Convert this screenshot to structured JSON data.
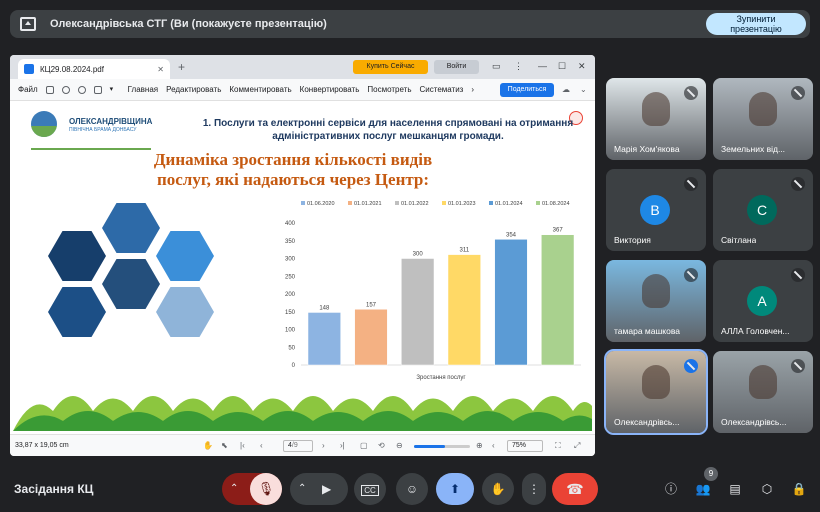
{
  "topbar": {
    "title": "Олександрівська СТГ (Ви (покажуєте презентацію)",
    "stop_label_1": "Зупинити",
    "stop_label_2": "презентацію"
  },
  "pdf": {
    "tab_title": "КЦ29.08.2024.pdf",
    "buy_label": "Купить Сейчас",
    "login_label": "Войти",
    "menu": [
      "Файл",
      "Главная",
      "Редактировать",
      "Комментировать",
      "Конвертировать",
      "Посмотреть",
      "Систематиз"
    ],
    "share_label": "Поделиться",
    "dimensions": "33,87 x 19,05 cm",
    "page": "4",
    "page_total": "/9",
    "zoom": "75%",
    "zoom_level": 0.55
  },
  "slide": {
    "logo_title": "ОЛЕКСАНДРІВЩИНА",
    "logo_subtitle": "ПІВНІЧНА БРАМА ДОНБАСУ",
    "heading": "1. Послуги та електронні сервіси для населення спрямовані на отримання адміністративних послуг мешканцям громади.",
    "title_line1": "Динаміка зростання кількості видів",
    "title_line2": "послуг, які надаються через Центр:"
  },
  "chart_data": {
    "type": "bar",
    "categories": [
      "01.06.2020",
      "01.01.2021",
      "01.01.2022",
      "01.01.2023",
      "01.01.2024",
      "01.08.2024"
    ],
    "values": [
      148,
      157,
      300,
      311,
      354,
      367
    ],
    "colors": [
      "#8db4e2",
      "#f4b183",
      "#bfbfbf",
      "#ffd966",
      "#5b9bd5",
      "#a9d18e"
    ],
    "yticks": [
      0,
      50,
      100,
      150,
      200,
      250,
      300,
      350,
      400
    ],
    "ylim": [
      0,
      400
    ],
    "xlabel": "Зростання послуг",
    "legend": "top"
  },
  "participants": [
    {
      "name": "Марія Хом'якова",
      "type": "photo",
      "bg": "#dfe6e9"
    },
    {
      "name": "Земельних від...",
      "type": "photo",
      "bg": "#b0b8bf"
    },
    {
      "name": "Виктория",
      "type": "avatar",
      "letter": "В",
      "color": "#1e88e5"
    },
    {
      "name": "Світлана",
      "type": "avatar",
      "letter": "С",
      "color": "#00695c"
    },
    {
      "name": "тамара машкова",
      "type": "photo",
      "bg": "#7ab8e0"
    },
    {
      "name": "АЛЛА Головчен...",
      "type": "avatar",
      "letter": "А",
      "color": "#00897b"
    },
    {
      "name": "Олександрівсь...",
      "type": "photo",
      "bg": "#c8b9a6"
    },
    {
      "name": "Олександрівсь...",
      "type": "photo",
      "bg": "#9aa3a8"
    }
  ],
  "bottom": {
    "meeting_title": "Засідання КЦ",
    "participant_count": "9",
    "accent": "#8ab4f8",
    "end_color": "#ea4335"
  }
}
